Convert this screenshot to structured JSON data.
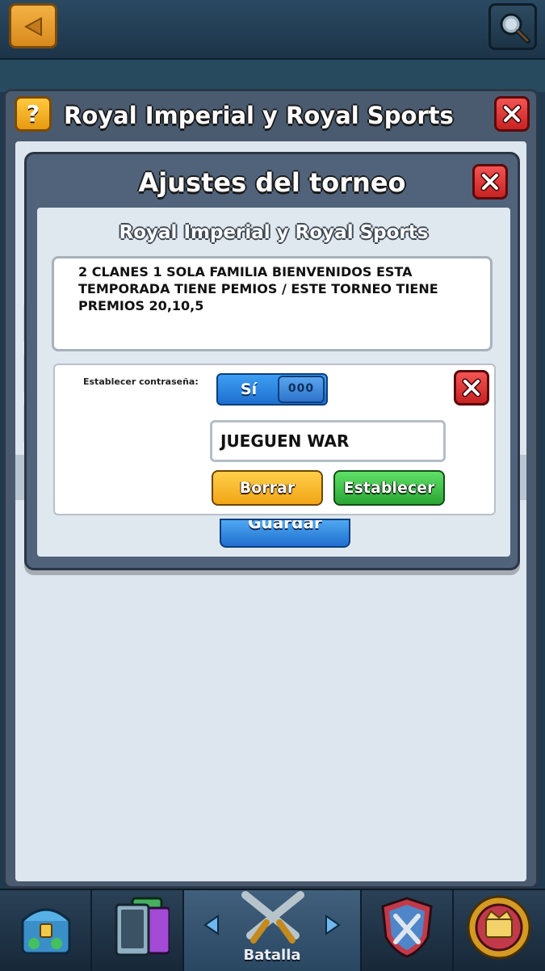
{
  "outer_dialog": {
    "title": "Royal Imperial y Royal Sports",
    "help_label": "?"
  },
  "tournament_settings": {
    "title": "Ajustes del torneo",
    "tournament_name": "Royal Imperial y Royal Sports",
    "description": "2 CLANES 1 SOLA FAMILIA BIENVENIDOS ESTA TEMPORADA TIENE PEMIOS / ESTE TORNEO TIENE PREMIOS 20,10,5",
    "password_label": "Establecer contraseña:",
    "password_toggle_label": "Sí",
    "password_toggle_knob": "000",
    "password_value": "JUEGUEN WAR",
    "clear_button": "Borrar",
    "set_button": "Establecer",
    "hidden_save_button": "Guardar"
  },
  "bottom_nav": {
    "active_tab_label": "Batalla"
  },
  "colors": {
    "accent_orange": "#f2a516",
    "accent_green": "#2aa633",
    "accent_blue": "#1f6fcf",
    "close_red": "#c82222"
  }
}
